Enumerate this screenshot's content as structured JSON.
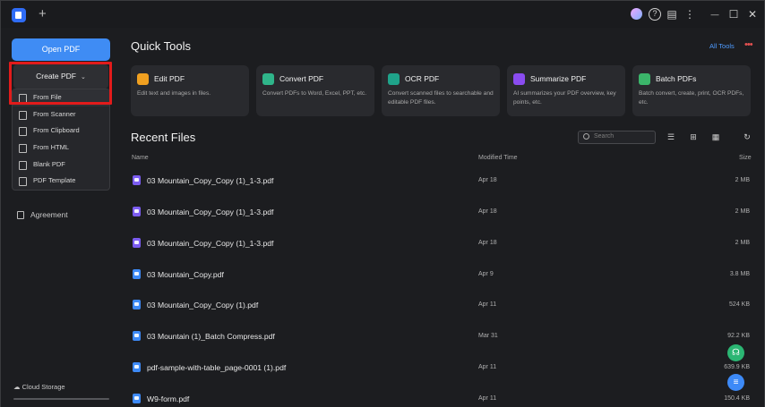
{
  "titlebar": {
    "new_tab": "+",
    "help": "?",
    "chat": "▤",
    "kebab": "⋮",
    "minimize": "—",
    "maximize": "☐",
    "close": "✕"
  },
  "sidebar": {
    "open_pdf": "Open PDF",
    "create_pdf": "Create PDF",
    "create_chevron": "⌄",
    "dropdown": [
      "From File",
      "From Scanner",
      "From Clipboard",
      "From HTML",
      "Blank PDF",
      "PDF Template"
    ],
    "agreement": "Agreement",
    "cloud_storage": "Cloud Storage"
  },
  "quick_tools": {
    "title": "Quick Tools",
    "all_tools": "All Tools",
    "more": "•••",
    "cards": [
      {
        "title": "Edit PDF",
        "desc": "Edit text and images in files.",
        "color": "#f0a020"
      },
      {
        "title": "Convert PDF",
        "desc": "Convert PDFs to Word, Excel, PPT, etc.",
        "color": "#2fb58a"
      },
      {
        "title": "OCR PDF",
        "desc": "Convert scanned files to searchable and editable PDF files.",
        "color": "#1fa38a"
      },
      {
        "title": "Summarize PDF",
        "desc": "AI summarizes your PDF overview, key points, etc.",
        "color": "#8a4cf0"
      },
      {
        "title": "Batch PDFs",
        "desc": "Batch convert, create, print, OCR PDFs, etc.",
        "color": "#3bb56a"
      }
    ]
  },
  "recent": {
    "title": "Recent Files",
    "search_placeholder": "Search",
    "columns": {
      "name": "Name",
      "modified": "Modified Time",
      "size": "Size"
    },
    "files": [
      {
        "name": "03 Mountain_Copy_Copy (1)_1-3.pdf",
        "modified": "Apr 18",
        "size": "2 MB",
        "icon_color": "#7b5cf0"
      },
      {
        "name": "03 Mountain_Copy_Copy (1)_1-3.pdf",
        "modified": "Apr 18",
        "size": "2 MB",
        "icon_color": "#7b5cf0"
      },
      {
        "name": "03 Mountain_Copy_Copy (1)_1-3.pdf",
        "modified": "Apr 18",
        "size": "2 MB",
        "icon_color": "#7b5cf0"
      },
      {
        "name": "03 Mountain_Copy.pdf",
        "modified": "Apr 9",
        "size": "3.8 MB",
        "icon_color": "#3d8af7"
      },
      {
        "name": "03 Mountain_Copy_Copy (1).pdf",
        "modified": "Apr 11",
        "size": "524 KB",
        "icon_color": "#3d8af7"
      },
      {
        "name": "03 Mountain (1)_Batch Compress.pdf",
        "modified": "Mar 31",
        "size": "92.2 KB",
        "icon_color": "#3d8af7"
      },
      {
        "name": "pdf-sample-with-table_page-0001 (1).pdf",
        "modified": "Apr 11",
        "size": "639.9 KB",
        "icon_color": "#3d8af7"
      },
      {
        "name": "W9-form.pdf",
        "modified": "Apr 11",
        "size": "150.4 KB",
        "icon_color": "#3d8af7"
      }
    ]
  },
  "fab": {
    "support": "☊",
    "assistant": "≡"
  }
}
